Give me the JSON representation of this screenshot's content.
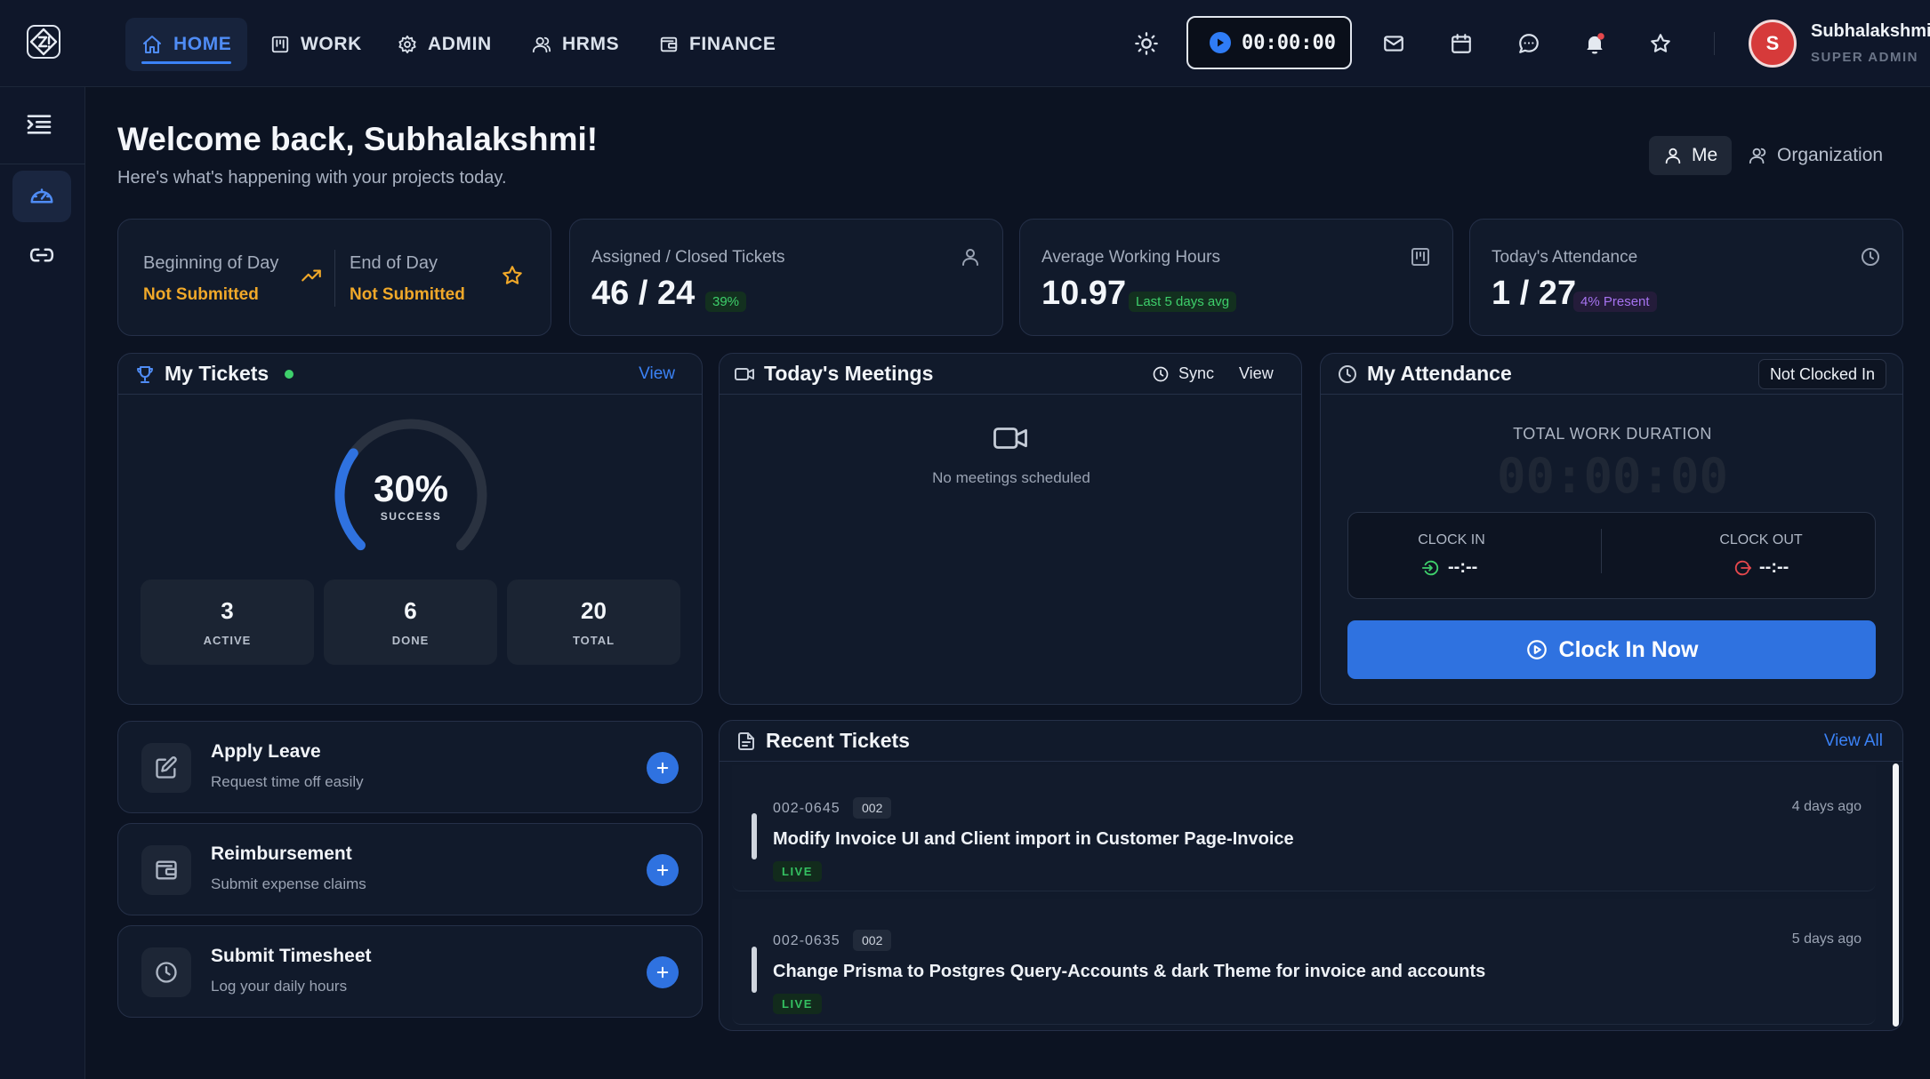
{
  "nav": {
    "items": [
      {
        "label": "HOME",
        "icon": "home-icon",
        "active": true
      },
      {
        "label": "WORK",
        "icon": "kanban-icon"
      },
      {
        "label": "ADMIN",
        "icon": "gear-icon"
      },
      {
        "label": "HRMS",
        "icon": "users-icon"
      },
      {
        "label": "FINANCE",
        "icon": "wallet-icon"
      }
    ],
    "timer": "00:00:00",
    "user": {
      "initial": "S",
      "name": "Subhalakshmi",
      "role": "SUPER ADMIN"
    }
  },
  "header": {
    "welcome": "Welcome back, Subhalakshmi!",
    "subtitle": "Here's what's happening with your projects today.",
    "scope_me": "Me",
    "scope_org": "Organization"
  },
  "stats": {
    "bod_label": "Beginning of Day",
    "bod_status": "Not Submitted",
    "eod_label": "End of Day",
    "eod_status": "Not Submitted",
    "tickets_label": "Assigned / Closed Tickets",
    "tickets_value": "46 / 24",
    "tickets_badge": "39%",
    "hours_label": "Average Working Hours",
    "hours_value": "10.97",
    "hours_badge": "Last 5 days avg",
    "attendance_label": "Today's Attendance",
    "attendance_value": "1 / 27",
    "attendance_badge": "4% Present"
  },
  "my_tickets": {
    "title": "My Tickets",
    "view": "View",
    "percent": "30%",
    "percent_value": 30,
    "percent_caption": "SUCCESS",
    "active_value": "3",
    "active_label": "ACTIVE",
    "done_value": "6",
    "done_label": "DONE",
    "total_value": "20",
    "total_label": "TOTAL"
  },
  "meetings": {
    "title": "Today's Meetings",
    "sync": "Sync",
    "view": "View",
    "empty": "No meetings scheduled"
  },
  "attendance": {
    "title": "My Attendance",
    "status": "Not Clocked In",
    "duration_label": "TOTAL WORK DURATION",
    "duration": "00:00:00",
    "clock_in_label": "CLOCK IN",
    "clock_in_value": "--:--",
    "clock_out_label": "CLOCK OUT",
    "clock_out_value": "--:--",
    "button": "Clock In Now"
  },
  "actions": [
    {
      "title": "Apply Leave",
      "subtitle": "Request time off easily",
      "icon": "edit-icon"
    },
    {
      "title": "Reimbursement",
      "subtitle": "Submit expense claims",
      "icon": "wallet-icon"
    },
    {
      "title": "Submit Timesheet",
      "subtitle": "Log your daily hours",
      "icon": "clock-icon"
    }
  ],
  "recent": {
    "title": "Recent Tickets",
    "view_all": "View All",
    "tickets": [
      {
        "id": "002-0645",
        "tag": "002",
        "title": "Modify Invoice UI and Client import in Customer Page-Invoice",
        "status": "LIVE",
        "ago": "4 days ago"
      },
      {
        "id": "002-0635",
        "tag": "002",
        "title": "Change Prisma to Postgres Query-Accounts & dark Theme for invoice and accounts",
        "status": "LIVE",
        "ago": "5 days ago"
      }
    ]
  },
  "colors": {
    "accent": "#3b82f6",
    "background": "#0c1322",
    "card": "#111a2b",
    "warning": "#f0a829",
    "success": "#3ecf6b",
    "danger": "#d63a3a"
  }
}
